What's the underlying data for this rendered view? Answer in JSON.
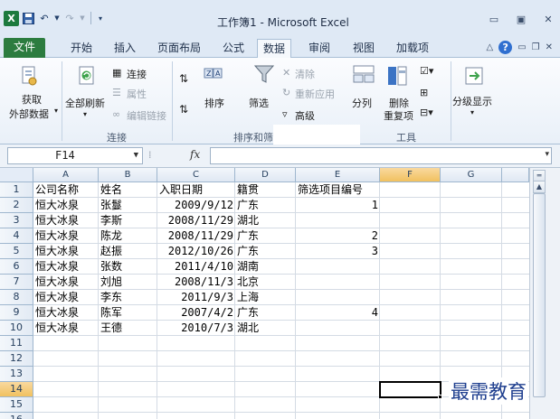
{
  "window": {
    "title": "工作簿1 - Microsoft Excel",
    "app_icon": "X",
    "accent_color": "#2c7c3f"
  },
  "tabs": {
    "file": "文件",
    "items": [
      "开始",
      "插入",
      "页面布局",
      "公式",
      "数据",
      "审阅",
      "视图",
      "加载项"
    ],
    "active": "数据"
  },
  "ribbon": {
    "get_external_data": [
      "获取",
      "外部数据"
    ],
    "refresh_all": "全部刷新",
    "connections": "连接",
    "properties": "属性",
    "edit_links": "编辑链接",
    "connections_group": "连接",
    "sort": "排序",
    "filter": "筛选",
    "clear": "清除",
    "reapply": "重新应用",
    "advanced": "高级",
    "sort_filter_group": "排序和筛",
    "text_to_columns": "分列",
    "remove_duplicates": [
      "删除",
      "重复项"
    ],
    "data_tools_group": "工具",
    "outline": "分级显示"
  },
  "formula_bar": {
    "name_box": "F14",
    "fx": "fx",
    "formula": ""
  },
  "sheet": {
    "columns": [
      "A",
      "B",
      "C",
      "D",
      "E",
      "F",
      "G"
    ],
    "selected_column": "F",
    "rows": [
      "1",
      "2",
      "3",
      "4",
      "5",
      "6",
      "7",
      "8",
      "9",
      "10",
      "11",
      "12",
      "13",
      "14",
      "15",
      "16"
    ],
    "selected_row": "14",
    "data": [
      [
        "公司名称",
        "姓名",
        "入职日期",
        "籍贯",
        "筛选项目编号"
      ],
      [
        "恒大冰泉",
        "张鬘",
        "2009/9/12",
        "广东",
        "1"
      ],
      [
        "恒大冰泉",
        "李斯",
        "2008/11/29",
        "湖北",
        ""
      ],
      [
        "恒大冰泉",
        "陈龙",
        "2008/11/29",
        "广东",
        "2"
      ],
      [
        "恒大冰泉",
        "赵振",
        "2012/10/26",
        "广东",
        "3"
      ],
      [
        "恒大冰泉",
        "张数",
        "2011/4/10",
        "湖南",
        ""
      ],
      [
        "恒大冰泉",
        "刘旭",
        "2008/11/3",
        "北京",
        ""
      ],
      [
        "恒大冰泉",
        "李东",
        "2011/9/3",
        "上海",
        ""
      ],
      [
        "恒大冰泉",
        "陈军",
        "2007/4/2",
        "广东",
        "4"
      ],
      [
        "恒大冰泉",
        "王德",
        "2010/7/3",
        "湖北",
        ""
      ]
    ]
  },
  "watermark": "最需教育"
}
